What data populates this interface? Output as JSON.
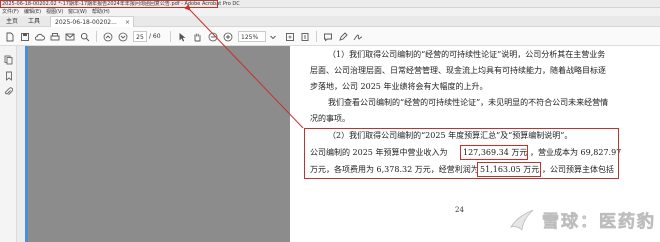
{
  "window": {
    "title": "2025-06-18-00202.02 *-17期年-17期年报告2024年年报问询函回复公告.pdf - Adobe Acrobat Pro DC"
  },
  "menubar": {
    "items": [
      "文件(F)",
      "编辑(E)",
      "视图(V)",
      "窗口(W)",
      "帮助(H)"
    ]
  },
  "tabs": {
    "home": "主页",
    "tools": "工具",
    "doc": "2025-06-18-00202...",
    "close": "×"
  },
  "toolbar": {
    "page_current": "25",
    "page_total": "/ 60",
    "zoom": "125%",
    "icons": [
      "new-file-icon",
      "save-icon",
      "upload-cloud-icon",
      "print-icon",
      "email-icon",
      "search-icon",
      "prev-page-icon",
      "next-page-icon",
      "cursor-select-icon",
      "hand-icon",
      "zoom-out-icon",
      "zoom-in-icon",
      "fit-page-icon",
      "scroll-icon",
      "comment-icon",
      "highlight-icon",
      "sign-icon"
    ]
  },
  "document": {
    "lines": [
      "（1）我们取得公司编制的“经营的可持续性论证”说明，公司分析其在主营业务",
      "层面、公司治理层面、日常经营管理、现金流上均具有可持续能力，随着战略目标逐",
      "步落地，公司 2025 年业绩将会有大幅度的上升。",
      "我们查看公司编制的“经营的可持续性论证”，未见明显的不符合公司未来经营情",
      "况的事项。",
      "（2）我们取得公司编制的“2025 年度预算汇总”及“预算编制说明”。",
      "公司编制的 2025 年预算中营业收入为",
      "127,369.34 万元",
      "，营业成本为 69,827.97",
      "万元，各项费用为 6,378.32 万元，经营利润为",
      "51,163.05 万元",
      "，公司预算主体包括"
    ],
    "page_number": "24"
  },
  "watermark": {
    "text": "雪球：医药豹"
  },
  "colors": {
    "highlight": "#c8312b",
    "side_pane": "#8c8c8c",
    "accent_blue": "#4d8fd6"
  }
}
